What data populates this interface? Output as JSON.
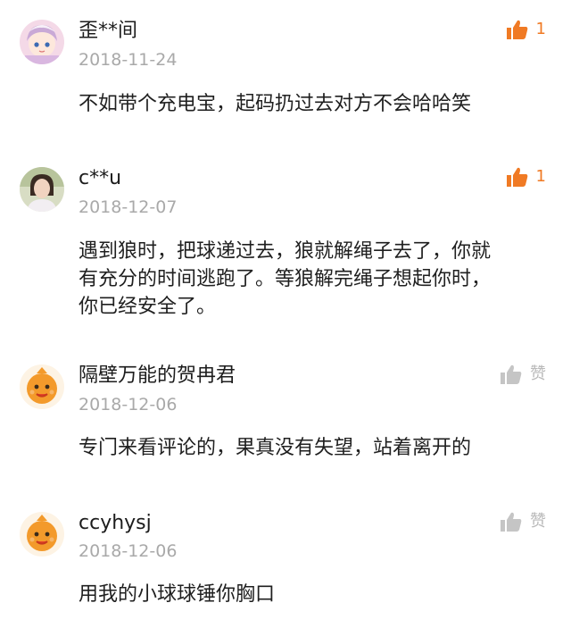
{
  "colors": {
    "like_active": "#f07a24",
    "like_inactive": "#c5c5c5"
  },
  "comments": [
    {
      "username": "歪**间",
      "date": "2018-11-24",
      "text": "不如带个充电宝，起码扔过去对方不会哈哈笑",
      "like_label": "1",
      "liked": true,
      "avatar_icon": "anime-girl-avatar"
    },
    {
      "username": "c**u",
      "date": "2018-12-07",
      "text": "遇到狼时，把球递过去，狼就解绳子去了，你就\n有充分的时间逃跑了。等狼解完绳子想起你时，\n你已经安全了。",
      "like_label": "1",
      "liked": true,
      "avatar_icon": "girl-photo-avatar"
    },
    {
      "username": "隔壁万能的贺冉君",
      "date": "2018-12-06",
      "text": "专门来看评论的，果真没有失望，站着离开的",
      "like_label": "赞",
      "liked": false,
      "avatar_icon": "orange-mascot-avatar"
    },
    {
      "username": "ccyhysj",
      "date": "2018-12-06",
      "text": "用我的小球球锤你胸口",
      "like_label": "赞",
      "liked": false,
      "avatar_icon": "orange-mascot-avatar"
    }
  ]
}
